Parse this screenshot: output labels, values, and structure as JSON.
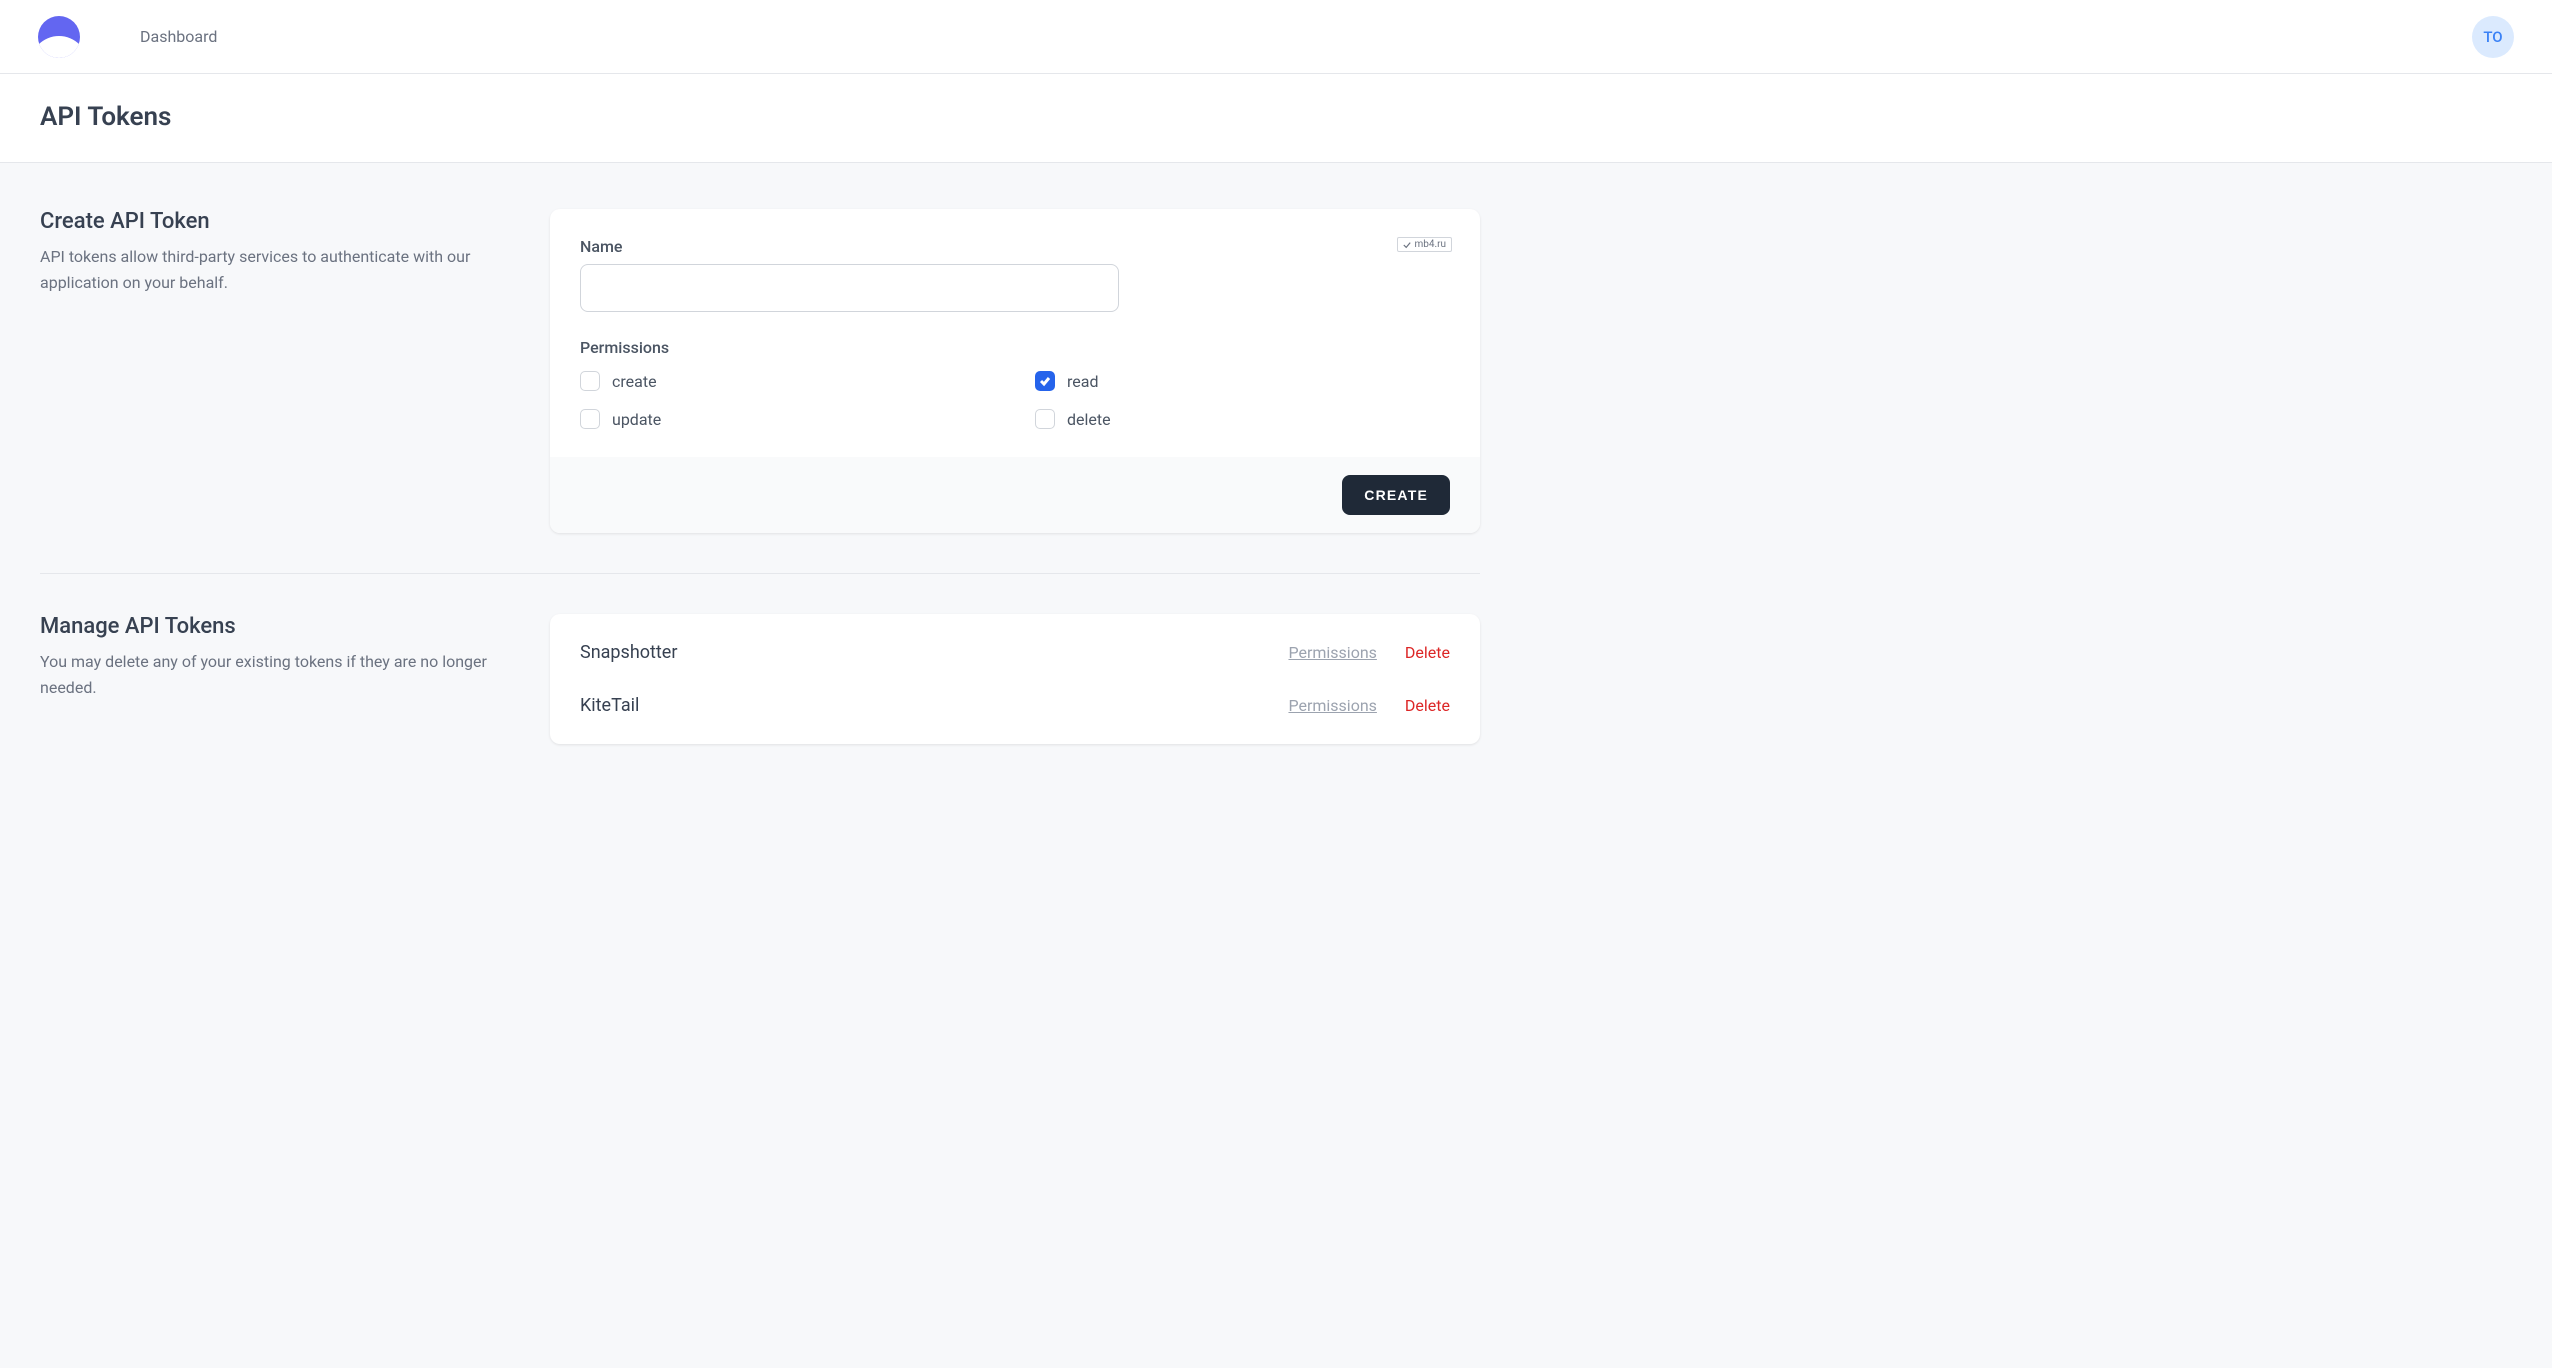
{
  "nav": {
    "dashboard_label": "Dashboard",
    "avatar_initials": "TO"
  },
  "page": {
    "title": "API Tokens"
  },
  "create_section": {
    "title": "Create API Token",
    "description": "API tokens allow third-party services to authenticate with our application on your behalf.",
    "name_label": "Name",
    "name_value": "",
    "permissions_label": "Permissions",
    "permissions": [
      {
        "key": "create",
        "label": "create",
        "checked": false
      },
      {
        "key": "read",
        "label": "read",
        "checked": true
      },
      {
        "key": "update",
        "label": "update",
        "checked": false
      },
      {
        "key": "delete",
        "label": "delete",
        "checked": false
      }
    ],
    "submit_label": "Create"
  },
  "manage_section": {
    "title": "Manage API Tokens",
    "description": "You may delete any of your existing tokens if they are no longer needed.",
    "permissions_link": "Permissions",
    "delete_link": "Delete",
    "tokens": [
      {
        "name": "Snapshotter"
      },
      {
        "name": "KiteTail"
      }
    ]
  },
  "watermark": "mb4.ru"
}
